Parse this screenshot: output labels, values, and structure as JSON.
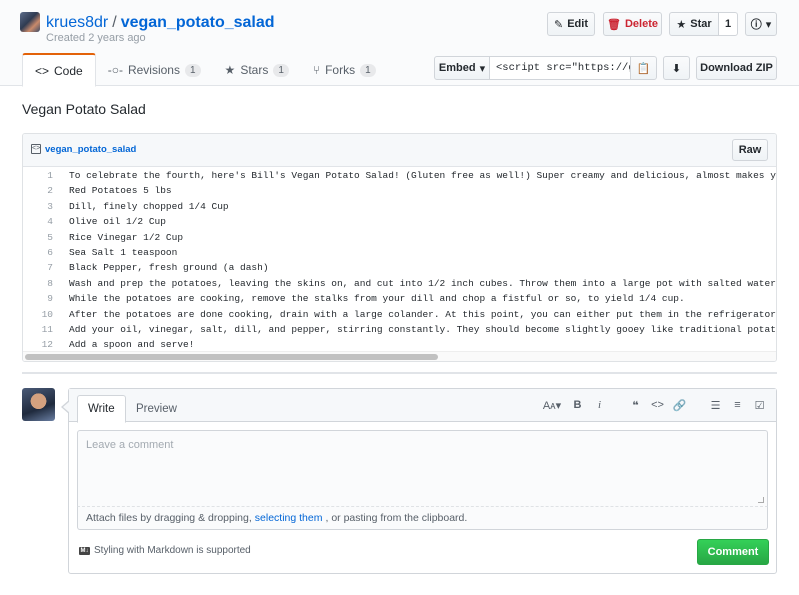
{
  "repo": {
    "owner": "krues8dr",
    "separator": "/",
    "gist_name": "vegan_potato_salad",
    "created": "Created 2 years ago"
  },
  "actions": {
    "edit": "Edit",
    "delete": "Delete",
    "star": "Star",
    "star_count": "1"
  },
  "tabs": [
    {
      "label": "Code",
      "count": ""
    },
    {
      "label": "Revisions",
      "count": "1"
    },
    {
      "label": "Stars",
      "count": "1"
    },
    {
      "label": "Forks",
      "count": "1"
    }
  ],
  "embed": {
    "label": "Embed",
    "value": "<script src=\"https://gist.",
    "download": "Download ZIP"
  },
  "description": "Vegan Potato Salad",
  "file": {
    "name": "vegan_potato_salad",
    "raw": "Raw",
    "lines": [
      "To celebrate the fourth, here's Bill's Vegan Potato Salad! (Gluten free as well!) Super creamy and delicious, almost makes you think you're",
      "Red Potatoes 5 lbs",
      "Dill, finely chopped 1/4 Cup",
      "Olive oil 1/2 Cup",
      "Rice Vinegar 1/2 Cup",
      "Sea Salt 1 teaspoon",
      "Black Pepper, fresh ground (a dash)",
      "Wash and prep the potatoes, leaving the skins on, and cut into 1/2 inch cubes. Throw them into a large pot with salted water, and boils for",
      "While the potatoes are cooking, remove the stalks from your dill and chop a fistful or so, to yield 1/4 cup.",
      "After the potatoes are done cooking, drain with a large colander. At this point, you can either put them in the refrigerator to cool, or sp",
      "Add your oil, vinegar, salt, dill, and pepper, stirring constantly. They should become slightly gooey like traditional potato salad.",
      "Add a spoon and serve!"
    ]
  },
  "comment": {
    "write_tab": "Write",
    "preview_tab": "Preview",
    "placeholder": "Leave a comment",
    "attach_before": "Attach files by dragging & dropping,",
    "attach_link": "selecting them",
    "attach_after": ", or pasting from the clipboard.",
    "markdown_note": "Styling with Markdown is supported",
    "submit": "Comment"
  },
  "colors": {
    "link": "#0366d6",
    "danger": "#cb2431",
    "success": "#28a745",
    "tab_accent": "#e36209"
  }
}
